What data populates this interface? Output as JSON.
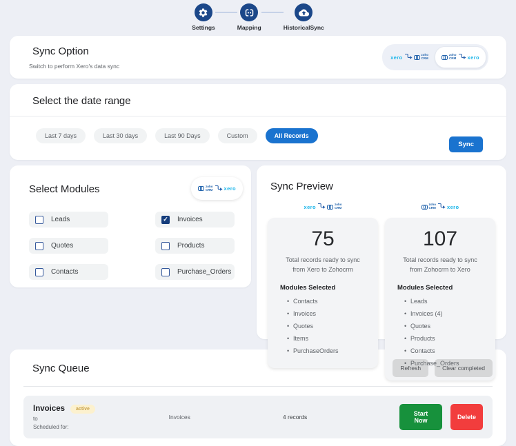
{
  "stepper": {
    "items": [
      {
        "label": "Settings",
        "icon": "gear-icon"
      },
      {
        "label": "Mapping",
        "icon": "mapping-icon"
      },
      {
        "label": "HistoricalSync",
        "icon": "cloud-sync-icon"
      }
    ]
  },
  "brands": {
    "xero": "xero",
    "zoho": "zoho",
    "zoho_crm": "CRM"
  },
  "sync_option": {
    "title": "Sync Option",
    "subtitle": "Switch to perform Xero's data sync",
    "toggle": {
      "left": {
        "direction": "xero-to-zoho"
      },
      "right": {
        "direction": "zoho-to-xero"
      },
      "selected": "right"
    }
  },
  "date_range": {
    "title": "Select the date range",
    "options": [
      {
        "label": "Last 7 days",
        "selected": false
      },
      {
        "label": "Last 30 days",
        "selected": false
      },
      {
        "label": "Last 90 Days",
        "selected": false
      },
      {
        "label": "Custom",
        "selected": false
      },
      {
        "label": "All Records",
        "selected": true
      }
    ],
    "sync_button": "Sync"
  },
  "modules": {
    "title": "Select Modules",
    "direction_badge": "zoho-to-xero",
    "items": [
      {
        "label": "Leads",
        "checked": false
      },
      {
        "label": "Invoices",
        "checked": true
      },
      {
        "label": "Quotes",
        "checked": false
      },
      {
        "label": "Products",
        "checked": false
      },
      {
        "label": "Contacts",
        "checked": false
      },
      {
        "label": "Purchase_Orders",
        "checked": false
      }
    ]
  },
  "sync_preview": {
    "title": "Sync Preview",
    "cards": [
      {
        "direction": "xero-to-zoho",
        "count": "75",
        "description": "Total records ready to sync from Xero to Zohocrm",
        "modules_heading": "Modules Selected",
        "modules": [
          "Contacts",
          "Invoices",
          "Quotes",
          "Items",
          "PurchaseOrders"
        ]
      },
      {
        "direction": "zoho-to-xero",
        "count": "107",
        "description": "Total records ready to sync from Zohocrm to Xero",
        "modules_heading": "Modules Selected",
        "modules": [
          "Leads",
          "Invoices (4)",
          "Quotes",
          "Products",
          "Contacts",
          "Purchase_Orders"
        ]
      }
    ]
  },
  "sync_queue": {
    "title": "Sync Queue",
    "refresh_button": "Refresh",
    "clear_button": "Clear completed",
    "items": [
      {
        "name": "Invoices",
        "status": "active",
        "to_label": "to",
        "scheduled_label": "Scheduled for:",
        "module": "Invoices",
        "records": "4 records",
        "start_button": "Start Now",
        "delete_button": "Delete"
      }
    ]
  },
  "colors": {
    "page_background": "#edeff5",
    "step_circle": "#1b4789",
    "accent_blue": "#1a73cf",
    "xero_cyan": "#19b5ea",
    "zoho_blue": "#2163ac",
    "success_green": "#17913c",
    "danger_red": "#f23d3d",
    "badge_background": "#fcf1ce",
    "badge_text": "#c9a24a"
  }
}
